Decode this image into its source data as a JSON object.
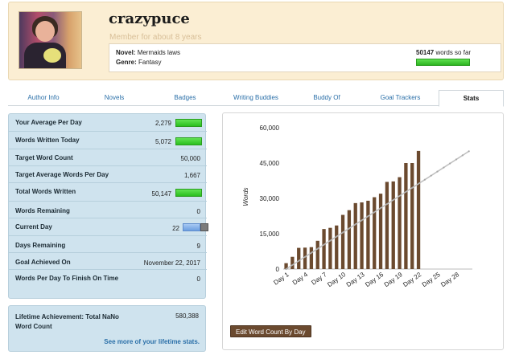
{
  "profile": {
    "username": "crazypuce",
    "member_since": "Member for about 8 years",
    "novel_label": "Novel:",
    "novel_title": "Mermaids laws",
    "genre_label": "Genre:",
    "genre_value": "Fantasy",
    "words_count": "50147",
    "words_suffix": "words so far",
    "progress_fraction": 1.0
  },
  "tabs": [
    {
      "label": "Author Info"
    },
    {
      "label": "Novels"
    },
    {
      "label": "Badges"
    },
    {
      "label": "Writing Buddies"
    },
    {
      "label": "Buddy Of"
    },
    {
      "label": "Goal Trackers"
    },
    {
      "label": "Stats",
      "active": true
    }
  ],
  "stats": {
    "rows": [
      {
        "label": "Your Average Per Day",
        "value": "2,279",
        "bar": "green"
      },
      {
        "label": "Words Written Today",
        "value": "5,072",
        "bar": "green"
      },
      {
        "label": "Target Word Count",
        "value": "50,000"
      },
      {
        "label": "Target Average Words Per Day",
        "value": "1,667"
      },
      {
        "label": "Total Words Written",
        "value": "50,147",
        "bar": "green"
      },
      {
        "label": "Words Remaining",
        "value": "0"
      },
      {
        "label": "Current Day",
        "value": "22",
        "bar": "day"
      },
      {
        "label": "Days Remaining",
        "value": "9"
      },
      {
        "label": "Goal Achieved On",
        "value": "November 22, 2017"
      },
      {
        "label": "Words Per Day To Finish On Time",
        "value": "0"
      }
    ],
    "lifetime_label": "Lifetime Achievement: Total NaNo Word Count",
    "lifetime_value": "580,388",
    "lifetime_link": "See more of your lifetime stats."
  },
  "chart_data": {
    "type": "bar",
    "ylabel": "Words",
    "ylim": [
      0,
      60000
    ],
    "yticks": [
      "0",
      "15,000",
      "30,000",
      "45,000",
      "60,000"
    ],
    "xtick_labels": [
      "Day 1",
      "Day 4",
      "Day 7",
      "Day 10",
      "Day 13",
      "Day 16",
      "Day 19",
      "Day 22",
      "Day 25",
      "Day 28"
    ],
    "days": 30,
    "values": [
      2500,
      5200,
      9000,
      9100,
      9300,
      12000,
      17000,
      17500,
      18500,
      23000,
      25000,
      28000,
      28300,
      29000,
      30500,
      32000,
      37000,
      37200,
      39000,
      45000,
      45000,
      50147
    ],
    "target_line": [
      0,
      50000
    ]
  },
  "chart_button": "Edit Word Count By Day",
  "colors": {
    "bar": "#6b4a2f",
    "target": "#bfbfbf",
    "green": "#3ccc2d"
  }
}
